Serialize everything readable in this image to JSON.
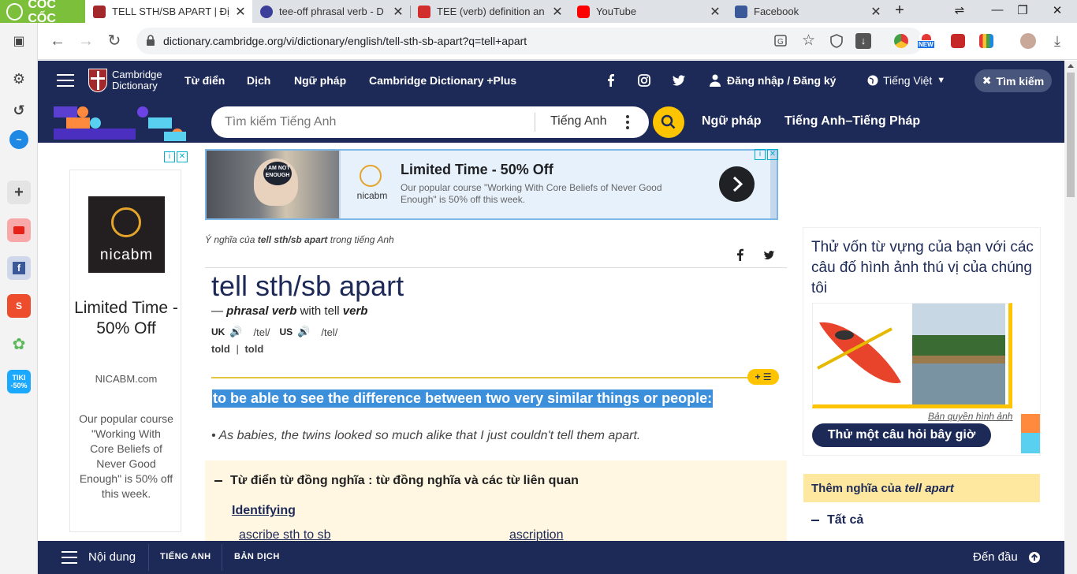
{
  "browser": {
    "brand": "CỐC CỐC",
    "tabs": [
      {
        "title": "TELL STH/SB APART | Đị",
        "active": true
      },
      {
        "title": "tee-off phrasal verb - D",
        "active": false
      },
      {
        "title": "TEE (verb) definition an",
        "active": false
      },
      {
        "title": "YouTube",
        "active": false
      },
      {
        "title": "Facebook",
        "active": false
      }
    ],
    "url": "dictionary.cambridge.org/vi/dictionary/english/tell-sth-sb-apart?q=tell+apart",
    "new_badge": "NEW",
    "tiki_badge": "TIKI",
    "tiki_discount": "-50%"
  },
  "site": {
    "brand_line1": "Cambridge",
    "brand_line2": "Dictionary",
    "nav": [
      "Từ điển",
      "Dịch",
      "Ngữ pháp",
      "Cambridge Dictionary +Plus"
    ],
    "login": "Đăng nhập / Đăng ký",
    "language": "Tiếng Việt",
    "search_pill": "Tìm kiếm",
    "search_placeholder": "Tìm kiếm Tiếng Anh",
    "search_lang": "Tiếng Anh",
    "subnav": [
      "Ngữ pháp",
      "Tiếng Anh–Tiếng Pháp"
    ]
  },
  "left_ad": {
    "logo_text": "nicabm",
    "title": "Limited Time - 50% Off",
    "domain": "NICABM.com",
    "body": "Our popular course \"Working With Core Beliefs of Never Good Enough\" is 50% off this week."
  },
  "banner_ad": {
    "image_text": "I AM NOT ENOUGH",
    "logo_text": "nicabm",
    "headline": "Limited Time - 50% Off",
    "description": "Our popular course \"Working With Core Beliefs of Never Good Enough\" is 50% off this week."
  },
  "entry": {
    "crumb_prefix": "Ý nghĩa của",
    "crumb_word": "tell sth/sb apart",
    "crumb_suffix": "trong tiếng Anh",
    "headword": "tell sth/sb apart",
    "pos_dash": "—",
    "pos": "phrasal verb",
    "pos_with": "with tell",
    "pos_verb": "verb",
    "uk_label": "UK",
    "uk_ipa": "/tel/",
    "us_label": "US",
    "us_ipa": "/tel/",
    "form1": "told",
    "form_sep": "|",
    "form2": "told",
    "plus_label": "+",
    "definition": "to be able to see the difference between two very similar things or people:",
    "example": "As babies, the twins looked so much alike that I just couldn't tell them apart.",
    "thesaurus_title": "Từ điển từ đồng nghĩa : từ đồng nghĩa và các từ liên quan",
    "thesaurus_sub": "Identifying",
    "thesaurus_links": [
      "ascribe sth to sb",
      "ascription"
    ]
  },
  "quiz": {
    "prompt": "Thử vốn từ vựng của bạn với các câu đố hình ảnh thú vị của chúng tôi",
    "credit": "Bản quyền hình ảnh",
    "cta": "Thử một câu hỏi bây giờ"
  },
  "more": {
    "prefix": "Thêm nghĩa của",
    "word": "tell apart",
    "all": "Tất cả"
  },
  "bottom_bar": {
    "contents": "Nội dung",
    "english": "TIẾNG ANH",
    "translation": "BẢN DỊCH",
    "to_top": "Đến đầu"
  },
  "colors": {
    "navy": "#1d2a57",
    "gold": "#fec400",
    "highlight": "#3b8fdb"
  }
}
